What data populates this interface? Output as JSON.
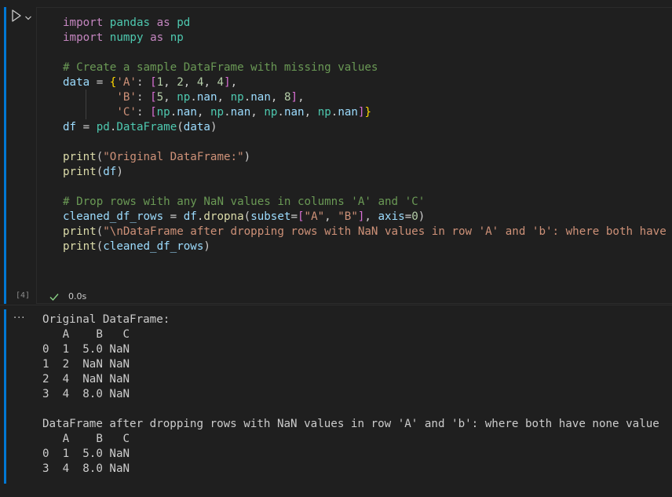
{
  "cell": {
    "execution_count": "[4]",
    "status_icon": "check-icon",
    "exec_time": "0.0s",
    "run_icon": "play-icon",
    "run_menu_icon": "chevron-down-icon",
    "output_menu_icon": "ellipsis-icon",
    "output_menu_label": "···",
    "code_lines": [
      [
        {
          "t": "import",
          "c": "kw"
        },
        {
          "t": " "
        },
        {
          "t": "pandas",
          "c": "mod"
        },
        {
          "t": " "
        },
        {
          "t": "as",
          "c": "kw"
        },
        {
          "t": " "
        },
        {
          "t": "pd",
          "c": "mod"
        }
      ],
      [
        {
          "t": "import",
          "c": "kw"
        },
        {
          "t": " "
        },
        {
          "t": "numpy",
          "c": "mod"
        },
        {
          "t": " "
        },
        {
          "t": "as",
          "c": "kw"
        },
        {
          "t": " "
        },
        {
          "t": "np",
          "c": "mod"
        }
      ],
      [],
      [
        {
          "t": "# Create a sample DataFrame with missing values",
          "c": "cmt"
        }
      ],
      [
        {
          "t": "data",
          "c": "var"
        },
        {
          "t": " = "
        },
        {
          "t": "{",
          "c": "br1"
        },
        {
          "t": "'A'",
          "c": "str"
        },
        {
          "t": ": "
        },
        {
          "t": "[",
          "c": "br2"
        },
        {
          "t": "1",
          "c": "num"
        },
        {
          "t": ", "
        },
        {
          "t": "2",
          "c": "num"
        },
        {
          "t": ", "
        },
        {
          "t": "4",
          "c": "num"
        },
        {
          "t": ", "
        },
        {
          "t": "4",
          "c": "num"
        },
        {
          "t": "]",
          "c": "br2"
        },
        {
          "t": ","
        }
      ],
      [
        {
          "t": "        "
        },
        {
          "t": "'B'",
          "c": "str"
        },
        {
          "t": ": "
        },
        {
          "t": "[",
          "c": "br2"
        },
        {
          "t": "5",
          "c": "num"
        },
        {
          "t": ", "
        },
        {
          "t": "np",
          "c": "mod"
        },
        {
          "t": "."
        },
        {
          "t": "nan",
          "c": "var"
        },
        {
          "t": ", "
        },
        {
          "t": "np",
          "c": "mod"
        },
        {
          "t": "."
        },
        {
          "t": "nan",
          "c": "var"
        },
        {
          "t": ", "
        },
        {
          "t": "8",
          "c": "num"
        },
        {
          "t": "]",
          "c": "br2"
        },
        {
          "t": ","
        }
      ],
      [
        {
          "t": "        "
        },
        {
          "t": "'C'",
          "c": "str"
        },
        {
          "t": ": "
        },
        {
          "t": "[",
          "c": "br2"
        },
        {
          "t": "np",
          "c": "mod"
        },
        {
          "t": "."
        },
        {
          "t": "nan",
          "c": "var"
        },
        {
          "t": ", "
        },
        {
          "t": "np",
          "c": "mod"
        },
        {
          "t": "."
        },
        {
          "t": "nan",
          "c": "var"
        },
        {
          "t": ", "
        },
        {
          "t": "np",
          "c": "mod"
        },
        {
          "t": "."
        },
        {
          "t": "nan",
          "c": "var"
        },
        {
          "t": ", "
        },
        {
          "t": "np",
          "c": "mod"
        },
        {
          "t": "."
        },
        {
          "t": "nan",
          "c": "var"
        },
        {
          "t": "]",
          "c": "br2"
        },
        {
          "t": "}",
          "c": "br1"
        }
      ],
      [
        {
          "t": "df",
          "c": "var"
        },
        {
          "t": " = "
        },
        {
          "t": "pd",
          "c": "mod"
        },
        {
          "t": "."
        },
        {
          "t": "DataFrame",
          "c": "mod"
        },
        {
          "t": "("
        },
        {
          "t": "data",
          "c": "var"
        },
        {
          "t": ")"
        }
      ],
      [],
      [
        {
          "t": "print",
          "c": "fn"
        },
        {
          "t": "("
        },
        {
          "t": "\"Original DataFrame:\"",
          "c": "str"
        },
        {
          "t": ")"
        }
      ],
      [
        {
          "t": "print",
          "c": "fn"
        },
        {
          "t": "("
        },
        {
          "t": "df",
          "c": "var"
        },
        {
          "t": ")"
        }
      ],
      [],
      [
        {
          "t": "# Drop rows with any NaN values in columns 'A' and 'C'",
          "c": "cmt"
        }
      ],
      [
        {
          "t": "cleaned_df_rows",
          "c": "var"
        },
        {
          "t": " = "
        },
        {
          "t": "df",
          "c": "var"
        },
        {
          "t": "."
        },
        {
          "t": "dropna",
          "c": "fn"
        },
        {
          "t": "("
        },
        {
          "t": "subset",
          "c": "var"
        },
        {
          "t": "="
        },
        {
          "t": "[",
          "c": "br2"
        },
        {
          "t": "\"A\"",
          "c": "str"
        },
        {
          "t": ", "
        },
        {
          "t": "\"B\"",
          "c": "str"
        },
        {
          "t": "]",
          "c": "br2"
        },
        {
          "t": ", "
        },
        {
          "t": "axis",
          "c": "var"
        },
        {
          "t": "="
        },
        {
          "t": "0",
          "c": "num"
        },
        {
          "t": ")"
        }
      ],
      [
        {
          "t": "print",
          "c": "fn"
        },
        {
          "t": "("
        },
        {
          "t": "\"\\nDataFrame after dropping rows with NaN values in row 'A' and 'b': where both have n",
          "c": "str"
        }
      ],
      [
        {
          "t": "print",
          "c": "fn"
        },
        {
          "t": "("
        },
        {
          "t": "cleaned_df_rows",
          "c": "var"
        },
        {
          "t": ")"
        }
      ]
    ],
    "output_lines": [
      "Original DataFrame:",
      "   A    B   C",
      "0  1  5.0 NaN",
      "1  2  NaN NaN",
      "2  4  NaN NaN",
      "3  4  8.0 NaN",
      "",
      "DataFrame after dropping rows with NaN values in row 'A' and 'b': where both have none value",
      "   A    B   C",
      "0  1  5.0 NaN",
      "3  4  8.0 NaN"
    ]
  },
  "colors": {
    "background": "#1f1f1f",
    "accent": "#0078d4",
    "success": "#89d185"
  }
}
